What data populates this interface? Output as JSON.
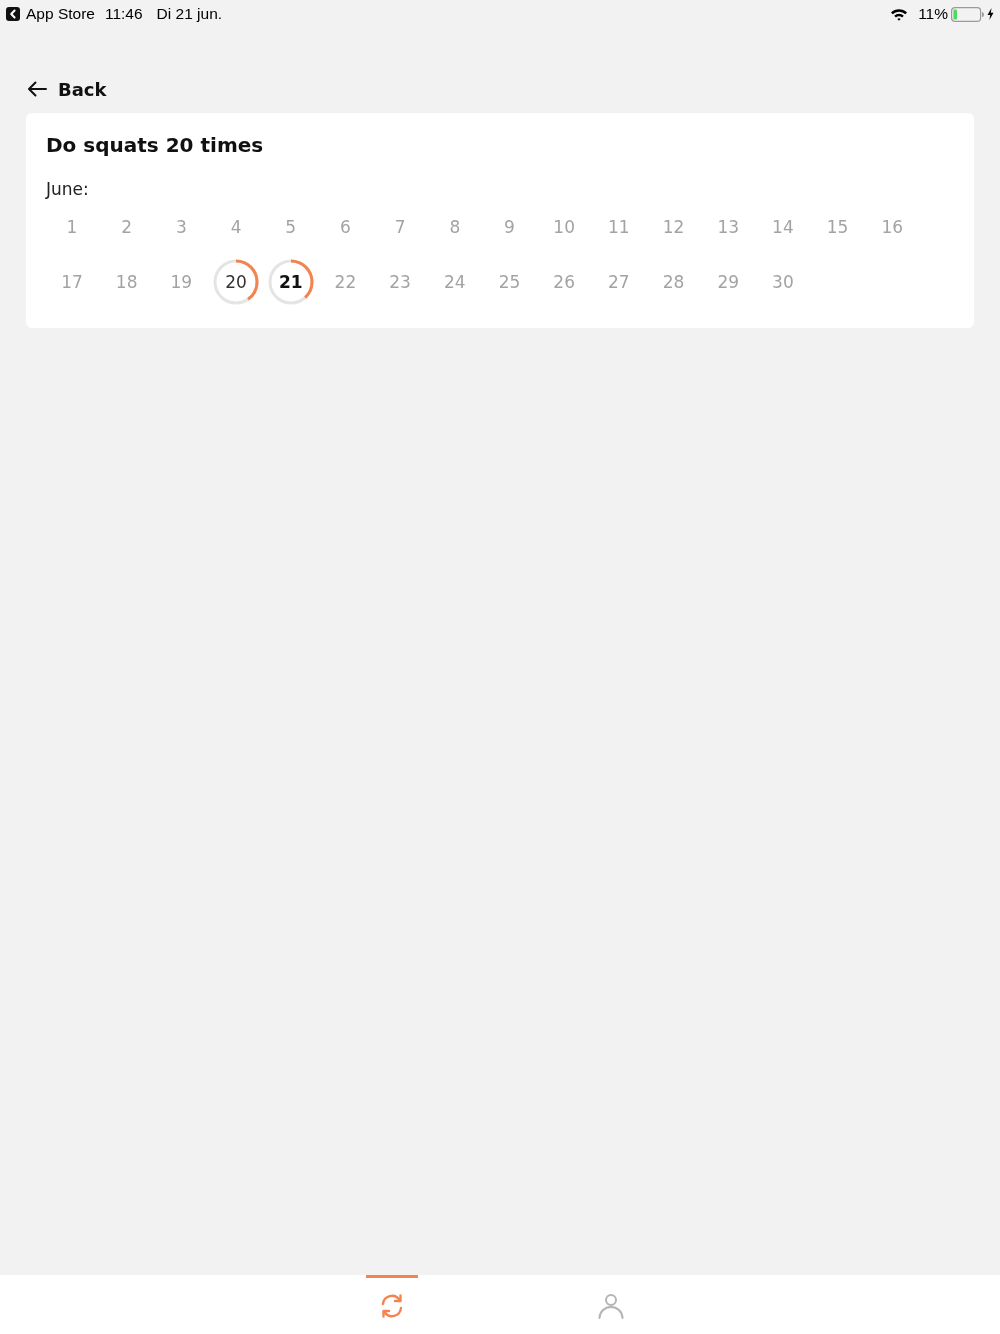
{
  "status_bar": {
    "back_app": "App Store",
    "time": "11:46",
    "date": "Di 21 jun.",
    "battery": "11%"
  },
  "back": {
    "label": "Back"
  },
  "habit": {
    "title": "Do squats 20 times",
    "month": "June:",
    "days": [
      {
        "label": "1",
        "today": false
      },
      {
        "label": "2",
        "today": false
      },
      {
        "label": "3",
        "today": false
      },
      {
        "label": "4",
        "today": false
      },
      {
        "label": "5",
        "today": false
      },
      {
        "label": "6",
        "today": false
      },
      {
        "label": "7",
        "today": false
      },
      {
        "label": "8",
        "today": false
      },
      {
        "label": "9",
        "today": false
      },
      {
        "label": "10",
        "today": false
      },
      {
        "label": "11",
        "today": false
      },
      {
        "label": "12",
        "today": false
      },
      {
        "label": "13",
        "today": false
      },
      {
        "label": "14",
        "today": false
      },
      {
        "label": "15",
        "today": false
      },
      {
        "label": "16",
        "today": false
      },
      {
        "label": "17",
        "today": false
      },
      {
        "label": "18",
        "today": false
      },
      {
        "label": "19",
        "today": false
      },
      {
        "label": "20",
        "today": false,
        "level": 0.4
      },
      {
        "label": "21",
        "today": true,
        "level": 0.38
      },
      {
        "label": "22",
        "today": false
      },
      {
        "label": "23",
        "today": false
      },
      {
        "label": "24",
        "today": false
      },
      {
        "label": "25",
        "today": false
      },
      {
        "label": "26",
        "today": false
      },
      {
        "label": "27",
        "today": false
      },
      {
        "label": "28",
        "today": false
      },
      {
        "label": "29",
        "today": false
      },
      {
        "label": "30",
        "today": false
      }
    ]
  },
  "tab_bar": [
    {
      "kind": "sync",
      "selected": true
    },
    {
      "kind": "profile",
      "selected": false
    }
  ]
}
